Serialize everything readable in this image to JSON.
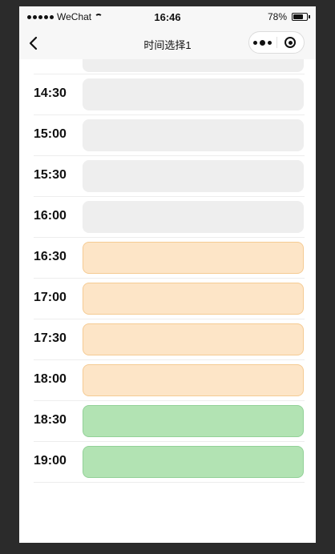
{
  "status": {
    "carrier": "WeChat",
    "time": "16:46",
    "battery": "78%",
    "battery_level": 0.78
  },
  "nav": {
    "title": "时间选择1",
    "back_icon": "chevron-left-icon",
    "more_icon": "more-dots-icon",
    "close_icon": "target-circle-icon"
  },
  "colors": {
    "unavailable": "#eeeeee",
    "booked": "#fde5c7",
    "available": "#b2e3b3"
  },
  "slots": [
    {
      "time": "14:30",
      "state": "gray"
    },
    {
      "time": "15:00",
      "state": "gray"
    },
    {
      "time": "15:30",
      "state": "gray"
    },
    {
      "time": "16:00",
      "state": "gray"
    },
    {
      "time": "16:30",
      "state": "orange"
    },
    {
      "time": "17:00",
      "state": "orange"
    },
    {
      "time": "17:30",
      "state": "orange"
    },
    {
      "time": "18:00",
      "state": "orange"
    },
    {
      "time": "18:30",
      "state": "green"
    },
    {
      "time": "19:00",
      "state": "green"
    }
  ]
}
